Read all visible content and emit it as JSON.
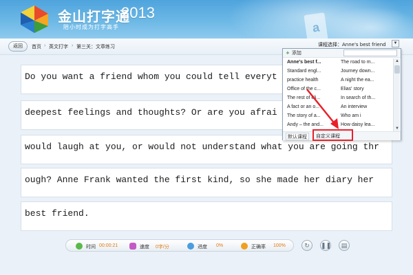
{
  "app": {
    "name": "金山打字通",
    "year": "2013",
    "tagline": "陪小时成为打字高手"
  },
  "toolbar": {
    "back_label": "返回",
    "breadcrumbs": [
      "首页",
      "英文打字",
      "第三关：文章练习"
    ],
    "breadcrumb_sep": "›",
    "course_select_label": "课程选择：Anne's best friend"
  },
  "lines": [
    "Do you want a friend whom you could tell everyt",
    "deepest feelings and thoughts? Or are you afrai",
    "would laugh at you, or would not understand what you are going thr",
    "ough? Anne Frank wanted the first kind, so she made her diary her",
    "best friend."
  ],
  "dropdown": {
    "add_label": "添加",
    "left_items": [
      "Anne's best f...",
      "Standard engl...",
      "practice health",
      "Office of the c...",
      "The rest of eli...",
      "A fact or an o...",
      "The story of a...",
      "Andy – the and..."
    ],
    "right_items": [
      "The road to m...",
      "Journey down...",
      "A night the ea...",
      "Elias' story",
      "In search of th...",
      "An interview",
      "Who am i",
      "How daisy lea..."
    ],
    "selected_index": 0,
    "tab_default": "默认课程",
    "tab_custom": "自定义课程"
  },
  "status": {
    "time_label": "时间",
    "time_value": "00:00:21",
    "speed_label": "速度",
    "speed_value": "0字/分",
    "progress_label": "进度",
    "progress_value": "0%",
    "accuracy_label": "正确率",
    "accuracy_value": "100%"
  },
  "colors": {
    "highlight_box": "#e8202a",
    "time_icon": "#5bb94a",
    "speed_icon": "#c45ac7",
    "progress_icon": "#4a9de0",
    "accuracy_icon": "#f0a020"
  }
}
